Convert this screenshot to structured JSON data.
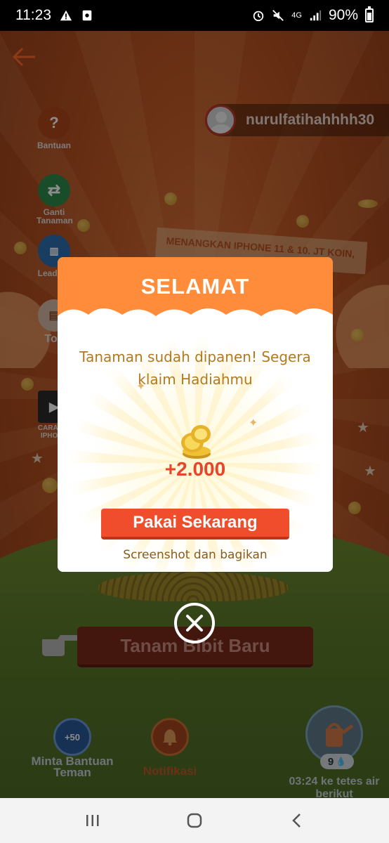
{
  "status_bar": {
    "time": "11:23",
    "battery": "90%",
    "network": "4G"
  },
  "header": {
    "username": "nurulfatihahhhh30"
  },
  "side_menu": [
    {
      "label": "Bantuan",
      "icon": "help-icon"
    },
    {
      "label": "Ganti Tanaman",
      "icon": "swap-icon"
    },
    {
      "label": "Leaderb",
      "icon": "leaderboard-icon"
    },
    {
      "label": "Tok",
      "icon": "shop-icon"
    },
    {
      "label": "CARA ME IPHONE",
      "icon": "video-icon"
    }
  ],
  "banner": {
    "text": "MENANGKAN IPHONE 11 & 10. JT KOIN,"
  },
  "modal": {
    "title": "SELAMAT",
    "message": "Tanaman sudah dipanen! Segera klaim Hadiahmu",
    "reward": "+2.000",
    "primary_button": "Pakai Sekarang",
    "secondary_link": "Screenshot dan bagikan"
  },
  "plant_button": {
    "label": "Tanam Bibit Baru"
  },
  "bottom_bar": {
    "help_friend_badge": "+50",
    "help_friend_label": "Minta Bantuan Teman",
    "notification_label": "Notifikasi",
    "water_drops": "9",
    "timer_text": "03:24 ke tetes air berikut"
  },
  "colors": {
    "modal_header": "#ff8c3a",
    "primary_button": "#ef4d2b",
    "reward_text": "#e8442a",
    "message_text": "#b27a1f"
  }
}
